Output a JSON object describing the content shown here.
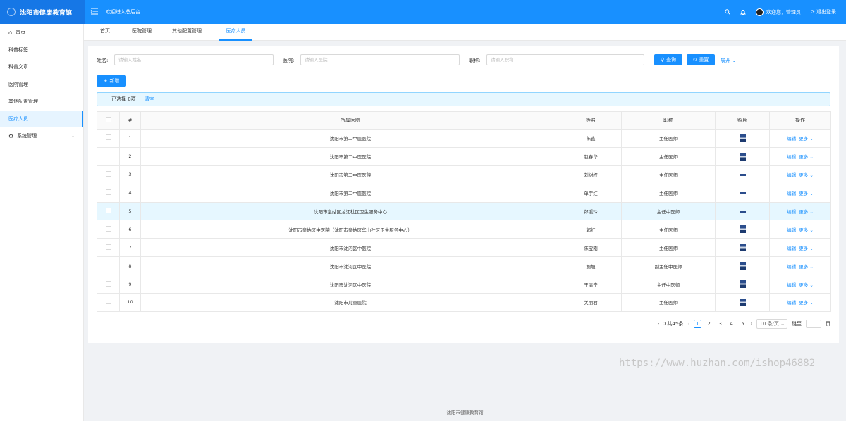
{
  "app": {
    "title": "沈阳市健康教育馆",
    "welcome": "欢迎进入总后台"
  },
  "topbar": {
    "user_greeting": "欢迎您，管理员",
    "logout": "退出登录"
  },
  "sidebar": {
    "items": [
      {
        "label": "首页",
        "icon": "home-icon"
      },
      {
        "label": "科普标签"
      },
      {
        "label": "科普文章"
      },
      {
        "label": "医院管理"
      },
      {
        "label": "其他配置管理"
      },
      {
        "label": "医疗人员",
        "active": true
      },
      {
        "label": "系统管理",
        "icon": "gear-icon",
        "expandable": true
      }
    ]
  },
  "tabs": [
    "首页",
    "医院管理",
    "其他配置管理",
    "医疗人员"
  ],
  "filters": {
    "name_label": "姓名:",
    "name_placeholder": "请输入姓名",
    "hospital_label": "医院:",
    "hospital_placeholder": "请输入医院",
    "title_label": "职称:",
    "title_placeholder": "请输入职称",
    "search_btn": "查询",
    "reset_btn": "重置",
    "expand": "展开"
  },
  "add_btn": "新增",
  "selection": {
    "text": "已选择 0项",
    "clear": "清空"
  },
  "table": {
    "headers": [
      "#",
      "所属医院",
      "姓名",
      "职称",
      "照片",
      "操作"
    ],
    "rows": [
      {
        "no": "1",
        "hospital": "沈阳市第二中医医院",
        "name": "陈鑫",
        "title": "主任医师"
      },
      {
        "no": "2",
        "hospital": "沈阳市第二中医医院",
        "name": "赵春华",
        "title": "主任医师"
      },
      {
        "no": "3",
        "hospital": "沈阳市第二中医医院",
        "name": "刘树权",
        "title": "主任医师"
      },
      {
        "no": "4",
        "hospital": "沈阳市第二中医医院",
        "name": "单宇红",
        "title": "主任医师"
      },
      {
        "no": "5",
        "hospital": "沈阳市皇姑区龙江社区卫生服务中心",
        "name": "郎溪玲",
        "title": "主任中医师"
      },
      {
        "no": "6",
        "hospital": "沈阳市皇姑区中医院（沈阳市皇姑区华山社区卫生服务中心）",
        "name": "郭红",
        "title": "主任医师"
      },
      {
        "no": "7",
        "hospital": "沈阳市沈河区中医院",
        "name": "陈宝刚",
        "title": "主任医师"
      },
      {
        "no": "8",
        "hospital": "沈阳市沈河区中医院",
        "name": "鲍旭",
        "title": "副主任中医师"
      },
      {
        "no": "9",
        "hospital": "沈阳市沈河区中医院",
        "name": "王清宁",
        "title": "主任中医师"
      },
      {
        "no": "10",
        "hospital": "沈阳市儿童医院",
        "name": "关丽君",
        "title": "主任医师"
      }
    ],
    "edit": "编辑",
    "more": "更多"
  },
  "pagination": {
    "summary": "1-10 共45条",
    "pages": [
      "1",
      "2",
      "3",
      "4",
      "5"
    ],
    "page_size": "10 条/页",
    "jump_label": "跳至",
    "page_suffix": "页"
  },
  "watermark": "https://www.huzhan.com/ishop46882",
  "footer": "沈阳市健康教育馆",
  "colors": {
    "primary": "#1890ff",
    "highlight": "#e6f7ff"
  }
}
